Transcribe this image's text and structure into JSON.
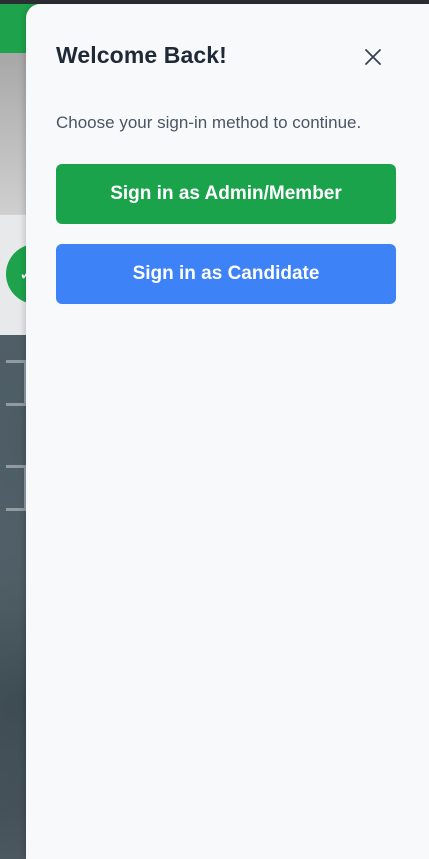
{
  "drawer": {
    "title": "Welcome Back!",
    "subtitle": "Choose your sign-in method to continue.",
    "close_icon": "close-icon"
  },
  "actions": {
    "admin_label": "Sign in as Admin/Member",
    "candidate_label": "Sign in as Candidate"
  },
  "background_page": {
    "fab_glyph": "✓"
  },
  "colors": {
    "brand_green": "#1ba34c",
    "brand_blue": "#3d82f6",
    "drawer_bg": "#f8f9fb",
    "title_text": "#1f2937",
    "subtitle_text": "#4b5563"
  }
}
